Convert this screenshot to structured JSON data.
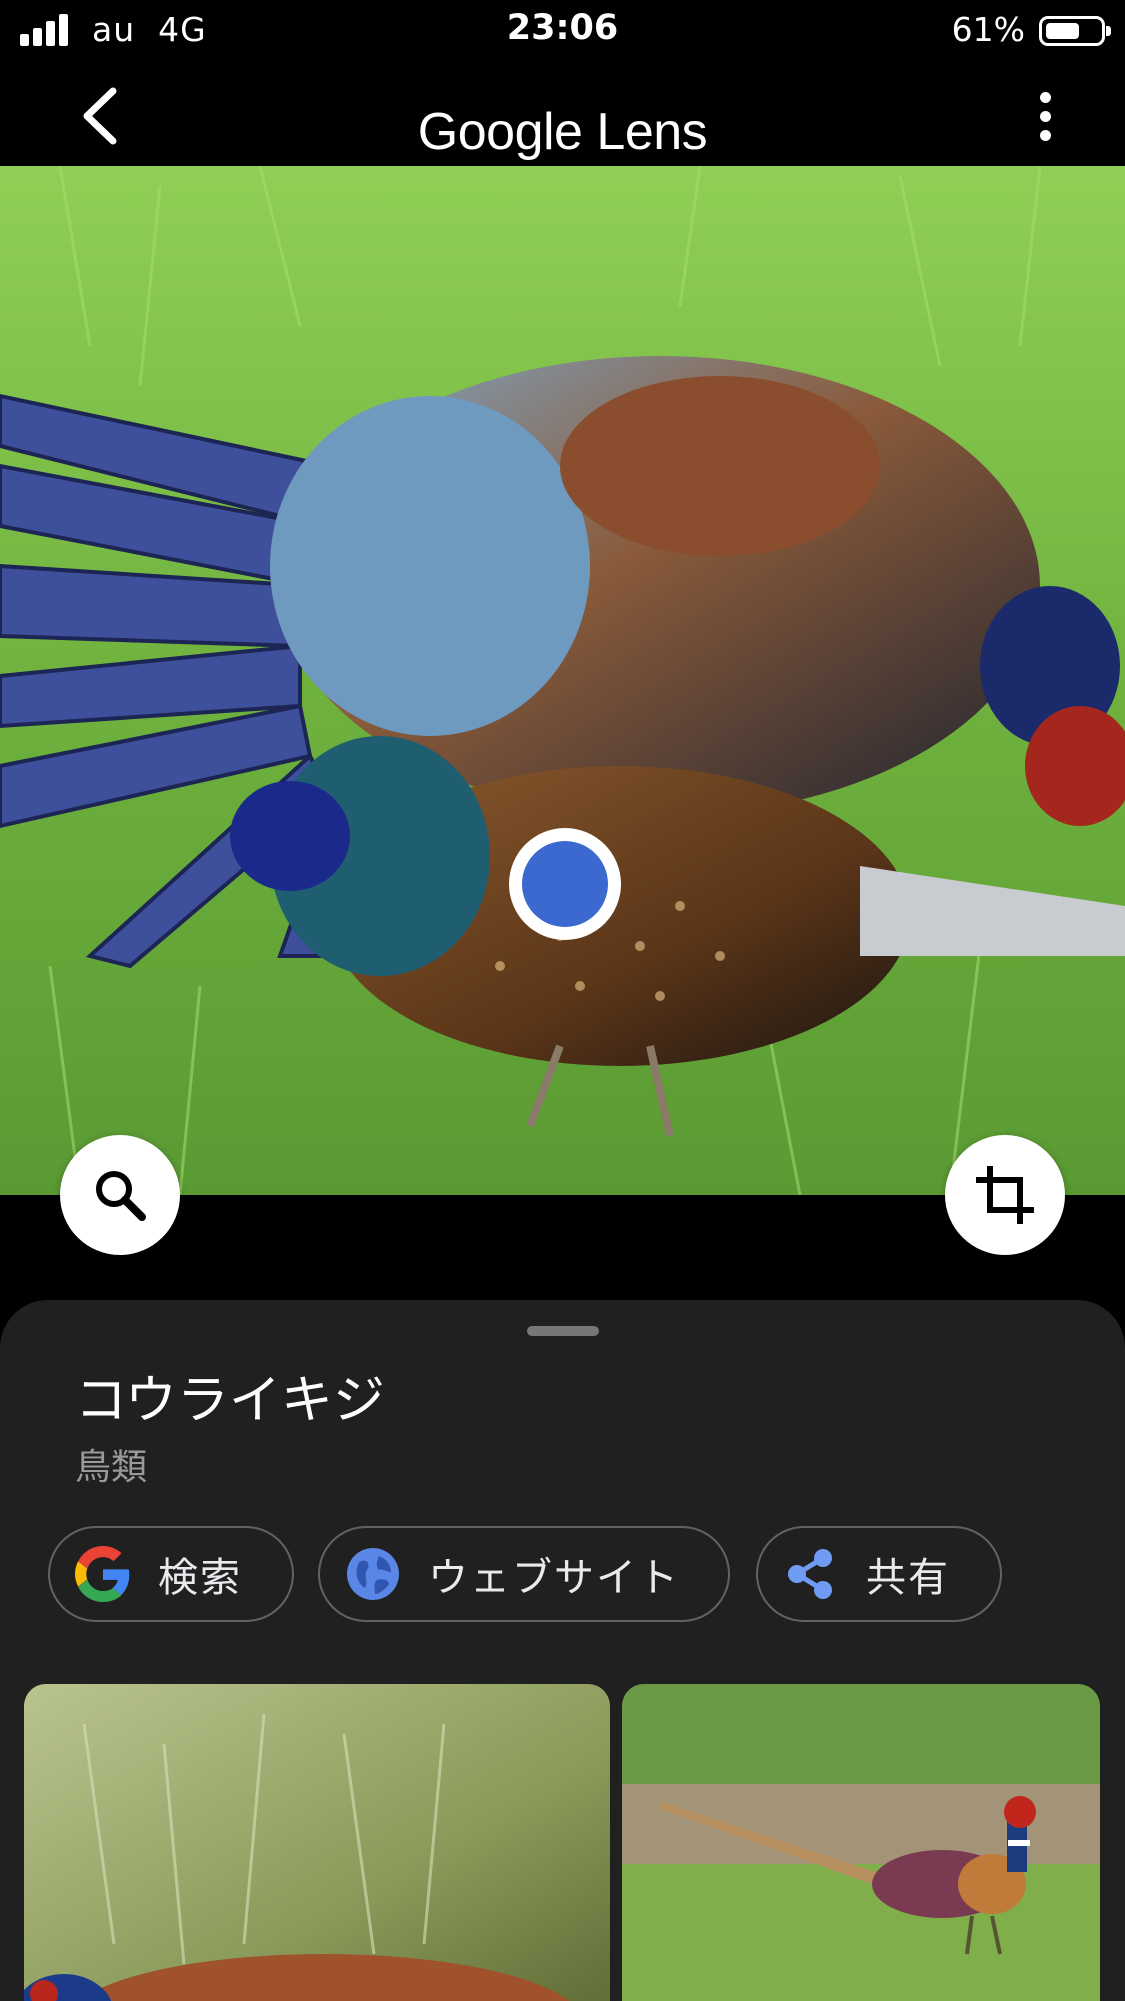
{
  "status_bar": {
    "carrier": "au",
    "network": "4G",
    "time": "23:06",
    "battery_percent": "61%",
    "battery_level": 0.61
  },
  "header": {
    "title": "Google Lens",
    "icons": {
      "back": "chevron-left-icon",
      "more": "more-vertical-icon"
    }
  },
  "photo": {
    "icons": {
      "search": "magnifier-icon",
      "crop": "crop-icon"
    },
    "colors": {
      "focus_dot": "#3b69d0"
    }
  },
  "result": {
    "title": "コウライキジ",
    "subtitle": "鳥類"
  },
  "actions": [
    {
      "label": "検索",
      "icon": "google-g-icon"
    },
    {
      "label": "ウェブサイト",
      "icon": "globe-icon"
    },
    {
      "label": "共有",
      "icon": "share-icon"
    }
  ],
  "colors": {
    "background": "#000000",
    "sheet": "#202020",
    "accent_blue": "#4285f4",
    "chip_border": "#5f6368"
  }
}
